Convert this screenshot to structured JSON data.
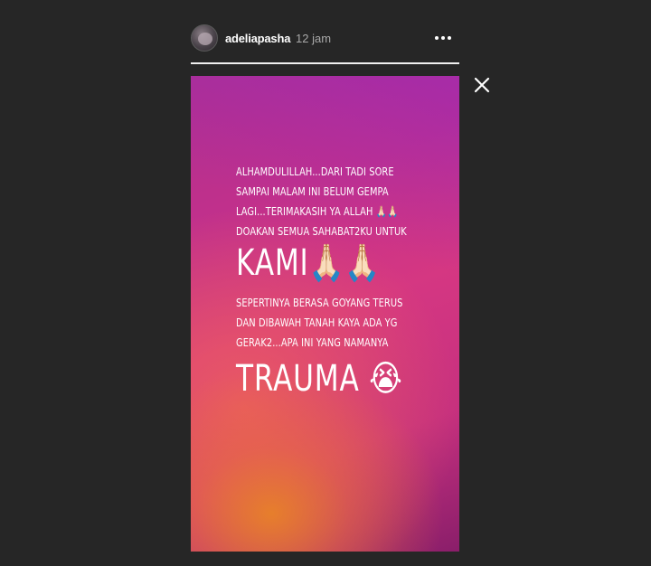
{
  "header": {
    "username": "adeliapasha",
    "time": "12 jam",
    "more_icon": "more-horizontal-icon",
    "avatar_icon": "profile-avatar"
  },
  "progress": {
    "fraction": 1.0
  },
  "close_icon": "close-icon",
  "story": {
    "block1_line1": "ALHAMDULILLAH...DARI TADI SORE",
    "block1_line2": "SAMPAI MALAM INI BELUM GEMPA",
    "block1_line3": "LAGI...TERIMAKASIH YA ALLAH 🙏🏻🙏🏻",
    "block1_line4": "DOAKAN SEMUA SAHABAT2KU UNTUK",
    "big_line1": "KAMI🙏🏻🙏🏻",
    "block3_line1": "SEPERTINYA BERASA GOYANG TERUS",
    "block3_line2": "DAN DIBAWAH TANAH KAYA ADA YG",
    "block3_line3": "GERAK2...APA INI YANG NAMANYA",
    "big_line2": "TRAUMA 😭"
  },
  "colors": {
    "background": "#262626",
    "story_pink": "#d53782",
    "story_purple": "#9a2fc0",
    "story_orange": "#e8822a"
  }
}
